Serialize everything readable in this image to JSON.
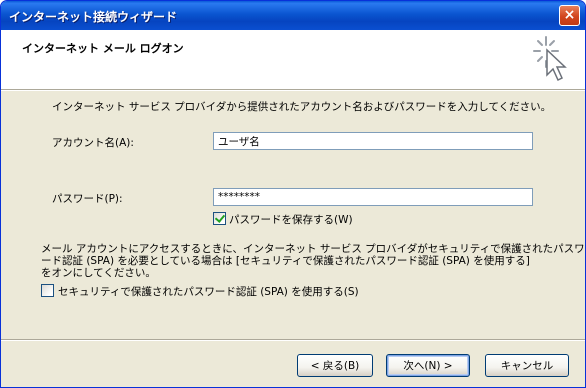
{
  "window": {
    "title": "インターネット接続ウィザード",
    "close_glyph": "×"
  },
  "header": {
    "title": "インターネット メール ログオン"
  },
  "body": {
    "intro": "インターネット サービス プロバイダから提供されたアカウント名およびパスワードを入力してください。",
    "account_label": "アカウント名(A):",
    "account_value": "ユーザ名",
    "password_label": "パスワード(P):",
    "password_value": "********",
    "save_password_label": "パスワードを保存する(W)",
    "save_password_checked": true,
    "spa_note_line1": "メール アカウントにアクセスするときに、インターネット サービス プロバイダがセキュリティで保護されたパスワ",
    "spa_note_line2": "ード認証 (SPA) を必要としている場合は [セキュリティで保護されたパスワード認証 (SPA) を使用する]",
    "spa_note_line3": "をオンにしてください。",
    "spa_label": "セキュリティで保護されたパスワード認証 (SPA) を使用する(S)",
    "spa_checked": false
  },
  "footer": {
    "back_label": "< 戻る(B)",
    "next_label": "次へ(N) >",
    "cancel_label": "キャンセル"
  },
  "colors": {
    "titlebar": "#0a55d0",
    "dialog_bg": "#ece9d8",
    "accent_border": "#003c74"
  }
}
